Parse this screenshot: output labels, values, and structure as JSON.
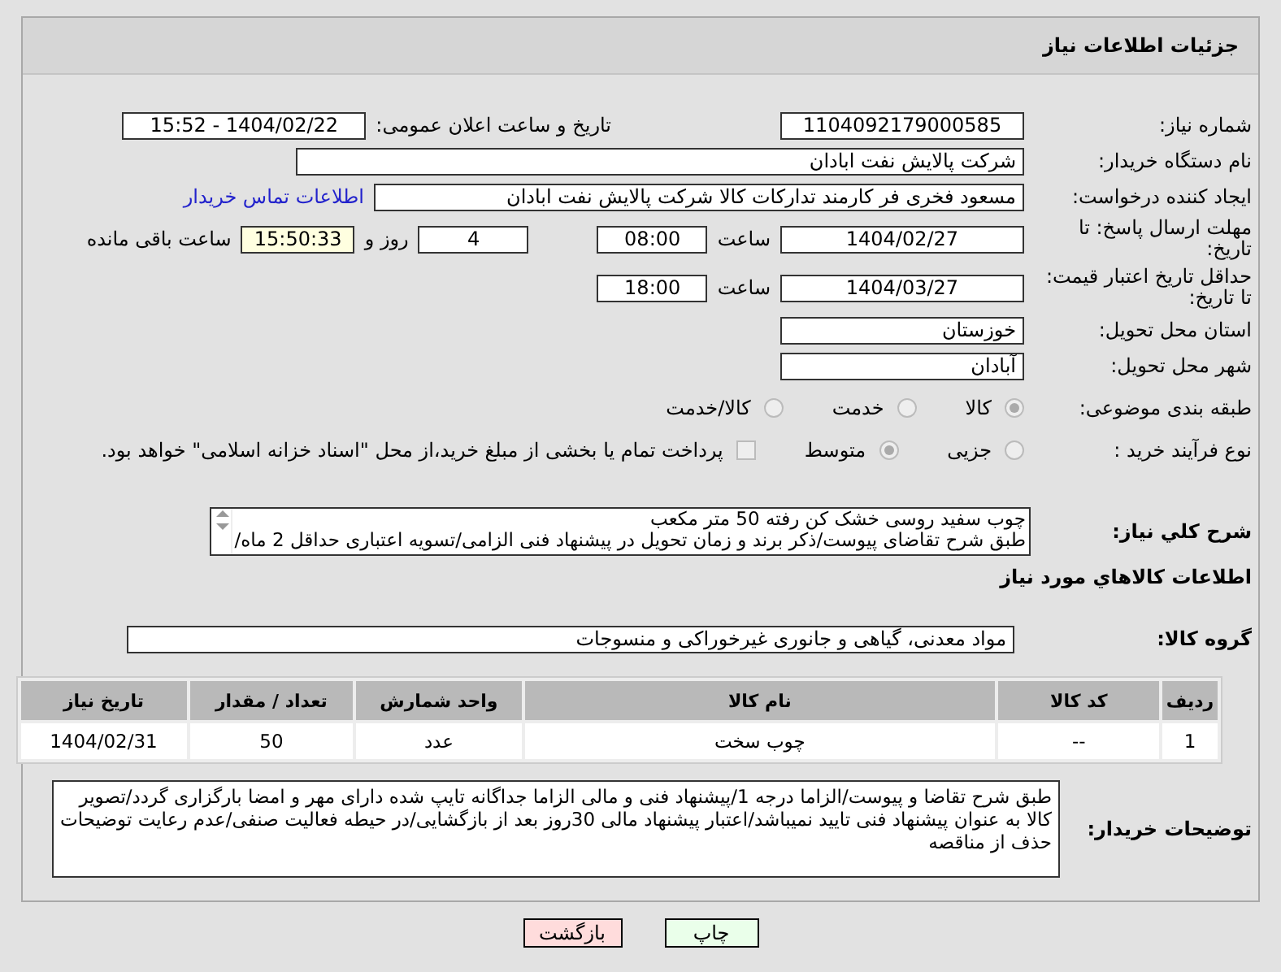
{
  "panel_title": "جزئیات اطلاعات نیاز",
  "need_number": {
    "label": "شماره نیاز:",
    "value": "1104092179000585"
  },
  "announcement": {
    "label": "تاریخ و ساعت اعلان عمومی:",
    "value": "1404/02/22 - 15:52"
  },
  "buyer_org": {
    "label": "نام دستگاه خریدار:",
    "value": "شرکت پالایش نفت ابادان"
  },
  "requester": {
    "label": "ایجاد کننده درخواست:",
    "value": "مسعود فخری فر کارمند تدارکات کالا شرکت پالایش نفت ابادان",
    "link": "اطلاعات تماس خریدار"
  },
  "reply_deadline": {
    "label": "مهلت ارسال پاسخ: تا تاریخ:",
    "date": "1404/02/27",
    "time_label": "ساعت",
    "time": "08:00",
    "days": "4",
    "days_label": "روز و",
    "remaining": "15:50:33",
    "remaining_label": "ساعت باقی مانده"
  },
  "price_validity": {
    "label": "حداقل تاریخ اعتبار قیمت: تا تاریخ:",
    "date": "1404/03/27",
    "time_label": "ساعت",
    "time": "18:00"
  },
  "province": {
    "label": "استان محل تحویل:",
    "value": "خوزستان"
  },
  "city": {
    "label": "شهر محل تحویل:",
    "value": "آبادان"
  },
  "category": {
    "label": "طبقه بندی موضوعی:",
    "options": [
      {
        "label": "کالا",
        "selected": true
      },
      {
        "label": "خدمت",
        "selected": false
      },
      {
        "label": "کالا/خدمت",
        "selected": false
      }
    ]
  },
  "process": {
    "label": "نوع فرآیند خرید :",
    "options": [
      {
        "label": "جزیی",
        "selected": false
      },
      {
        "label": "متوسط",
        "selected": true
      }
    ],
    "treasury": {
      "label": "پرداخت تمام یا بخشی از مبلغ خرید،از محل \"اسناد خزانه اسلامی\" خواهد بود.",
      "checked": false
    }
  },
  "description": {
    "label": "شرح کلي نياز:",
    "lines": [
      "چوب سفید روسی خشک کن رفته 50 متر مکعب",
      "طبق شرح تقاضای پیوست/ذکر برند و زمان تحویل در پیشنهاد فنی الزامی/تسویه اعتباری حداقل 2 ماه/"
    ]
  },
  "items_heading": "اطلاعات کالاهاي مورد نياز",
  "goods_group": {
    "label": "گروه کالا:",
    "value": "مواد معدنی، گیاهی و جانوری غیرخوراکی و منسوجات"
  },
  "table": {
    "columns": [
      "ردیف",
      "کد کالا",
      "نام کالا",
      "واحد شمارش",
      "تعداد / مقدار",
      "تاریخ نیاز"
    ],
    "rows": [
      [
        "1",
        "--",
        "چوب سخت",
        "عدد",
        "50",
        "1404/02/31"
      ]
    ]
  },
  "buyer_notes": {
    "label": "توضیحات خریدار:",
    "value": "طبق شرح تقاضا و پیوست/الزاما درجه 1/پیشنهاد فنی و مالی الزاما جداگانه تایپ شده دارای مهر و امضا بارگزاری گردد/تصویر کالا به عنوان پیشنهاد فنی تایید نمیباشد/اعتبار پیشنهاد مالی 30روز بعد از بازگشایی/در حیطه فعالیت صنفی/عدم رعایت توضیحات حذف از مناقصه"
  },
  "buttons": [
    {
      "label": "چاپ",
      "kind": "print"
    },
    {
      "label": "بازگشت",
      "kind": "back"
    }
  ]
}
